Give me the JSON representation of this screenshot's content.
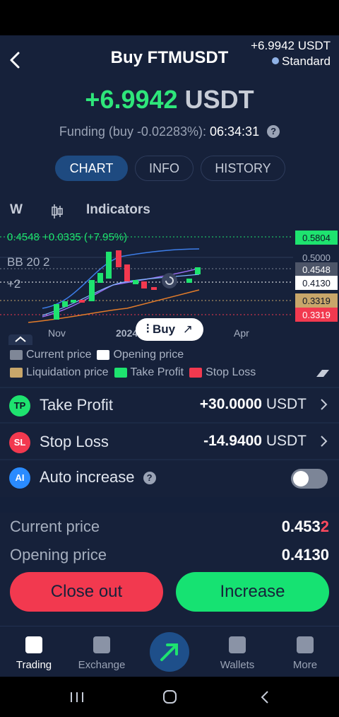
{
  "header": {
    "title": "Buy FTMUSDT",
    "top_right_value": "+6.9942 USDT",
    "account_mode": "Standard"
  },
  "pnl": {
    "value": "+6.9942",
    "currency": "USDT"
  },
  "funding": {
    "label": "Funding (buy -0.02283%):",
    "countdown": "06:34:31"
  },
  "tabs": [
    "CHART",
    "INFO",
    "HISTORY"
  ],
  "chart_toolbar": {
    "interval": "W",
    "indicators_label": "Indicators"
  },
  "chart": {
    "price_line": "0.4548 +0.0335 (+7.95%)",
    "bb_label": "BB 20 2",
    "plus_label": "+2",
    "x_ticks": [
      "Nov",
      "2024",
      "Apr"
    ],
    "price_tags": {
      "take_profit": "0.5804",
      "grid_level": "0.5000",
      "current": "0.4548",
      "opening": "0.4130",
      "liquidation": "0.3319",
      "stop_loss": "0.3319"
    },
    "buy_button": "Buy",
    "colors": {
      "green": "#1ee36f",
      "red": "#f2394f",
      "liquidation": "#c8a66a",
      "current": "#7f8797",
      "opening": "#ffffff"
    }
  },
  "legend": {
    "current_price": "Current price",
    "opening_price": "Opening price",
    "liquidation_price": "Liquidation price",
    "take_profit": "Take Profit",
    "stop_loss": "Stop Loss"
  },
  "rows": {
    "take_profit": {
      "icon": "TP",
      "label": "Take Profit",
      "amount": "+30.0000",
      "currency": "USDT"
    },
    "stop_loss": {
      "icon": "SL",
      "label": "Stop Loss",
      "amount": "-14.9400",
      "currency": "USDT"
    },
    "auto_increase": {
      "icon": "AI",
      "label": "Auto increase"
    }
  },
  "info": {
    "current_price_label": "Current price",
    "current_price_main": "0.453",
    "current_price_last": "2",
    "opening_price_label": "Opening price",
    "opening_price": "0.4130"
  },
  "actions": {
    "close": "Close out",
    "increase": "Increase"
  },
  "bottom_nav": [
    "Trading",
    "Exchange",
    "Wallets",
    "More"
  ]
}
